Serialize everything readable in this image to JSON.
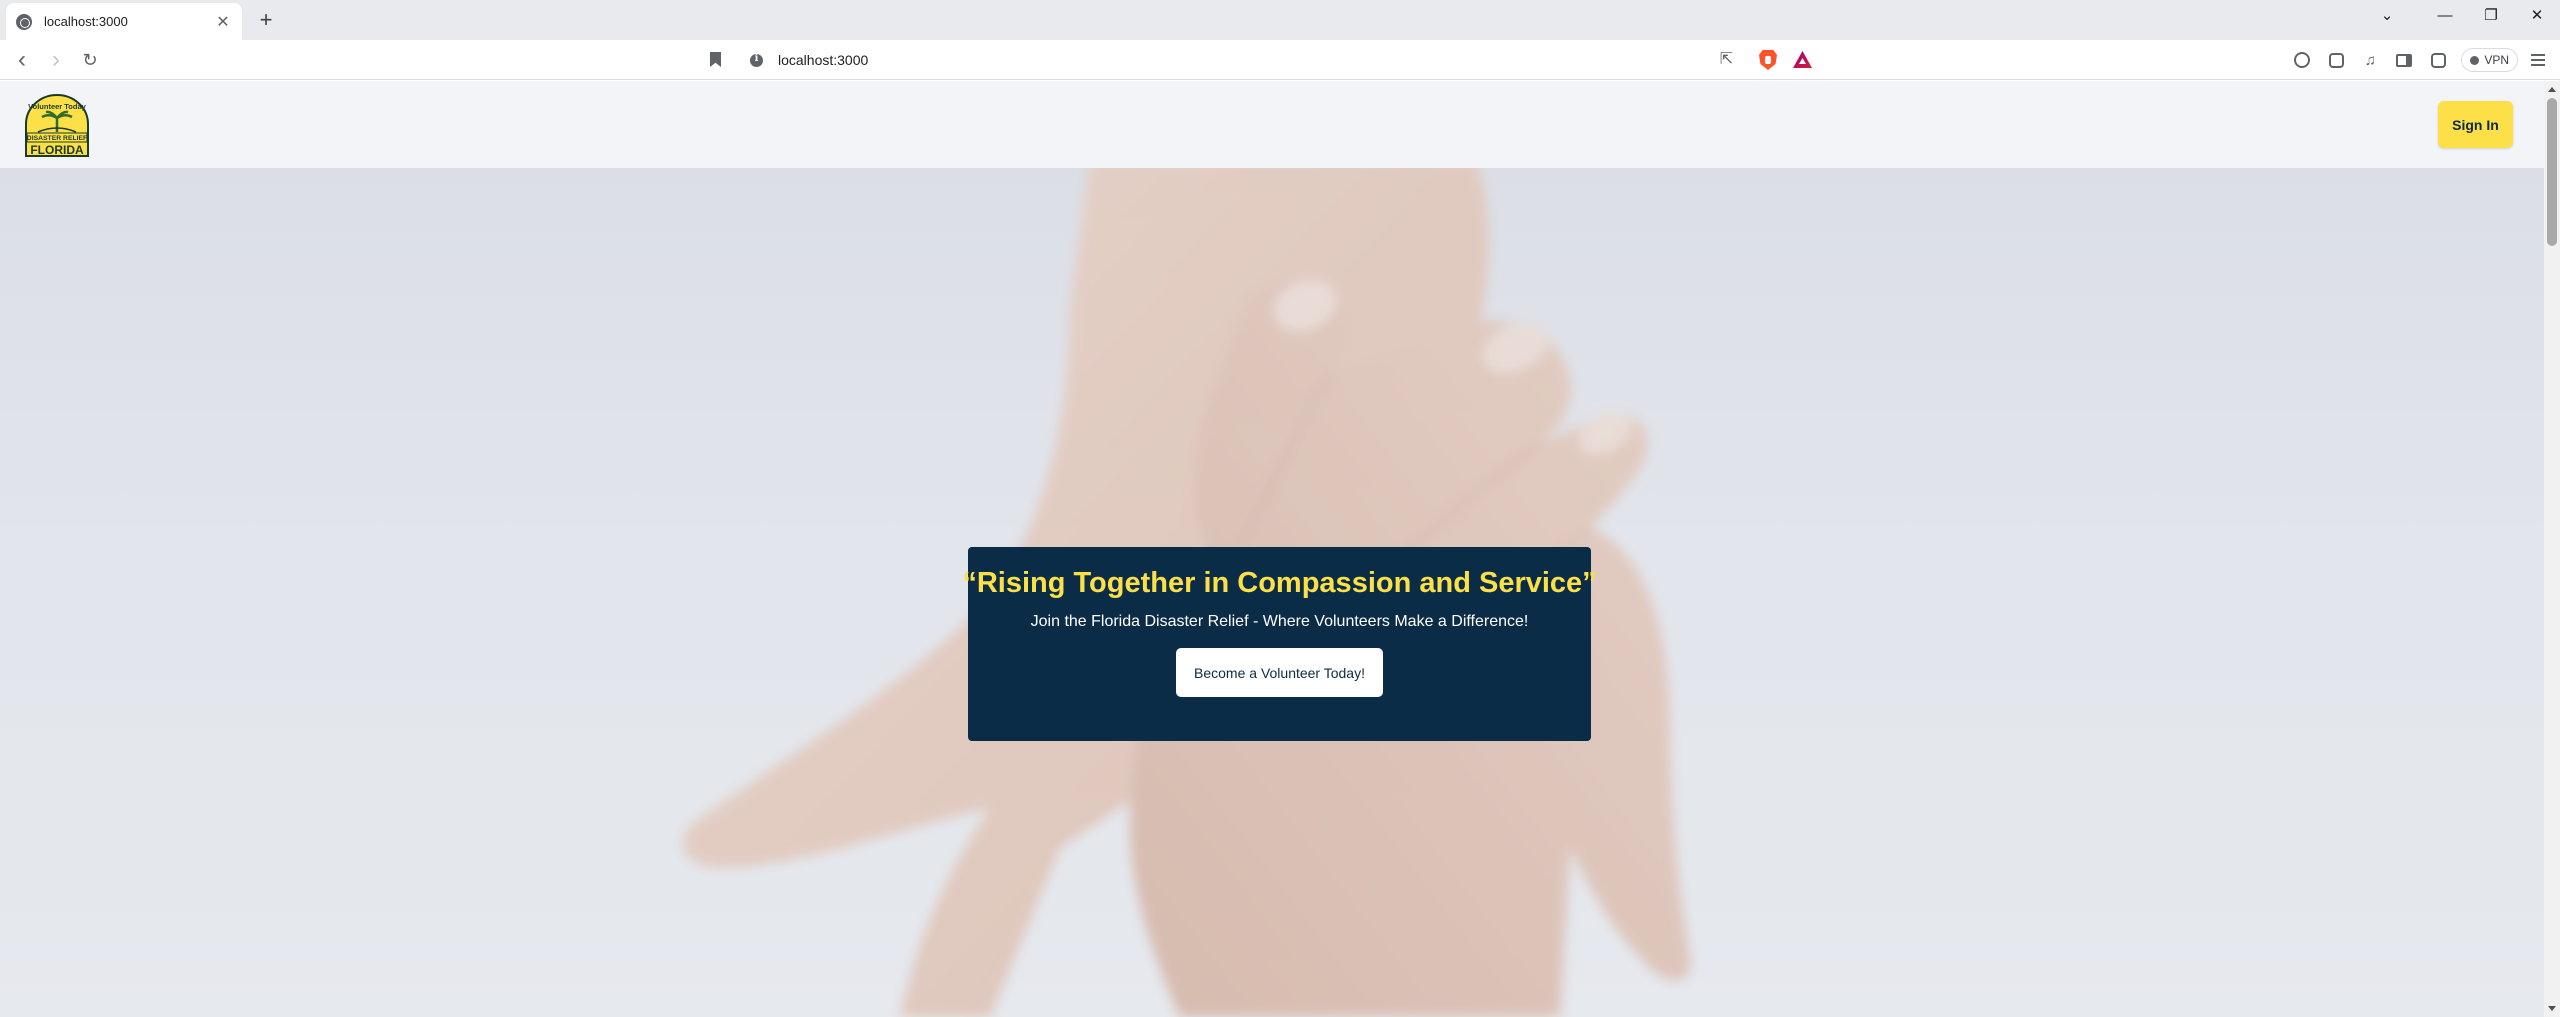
{
  "browser": {
    "tab": {
      "title": "localhost:3000",
      "close": "✕"
    },
    "new_tab": "+",
    "window_controls": {
      "chevron": "⌄",
      "minimize": "—",
      "restore": "❐",
      "close": "✕"
    },
    "nav": {
      "back": "‹",
      "forward": "›",
      "reload": "↻"
    },
    "url": "localhost:3000",
    "share": "⇱",
    "vpn_label": "VPN"
  },
  "site": {
    "logo": {
      "top_text": "Volunteer Today",
      "middle_text": "DISASTER RELIEF",
      "bottom_text": "FLORIDA",
      "colors": {
        "fill": "#fde047",
        "ink": "#1a3a2a"
      }
    },
    "header": {
      "signin_label": "Sign In"
    },
    "hero": {
      "title": "“Rising Together in Compassion and Service”",
      "subtitle": "Join the Florida Disaster Relief - Where Volunteers Make a Difference!",
      "cta_label": "Become a Volunteer Today!"
    }
  },
  "colors": {
    "accent_yellow": "#fde047",
    "navy": "#0b2c46",
    "header_bg": "#f2f4f7"
  }
}
